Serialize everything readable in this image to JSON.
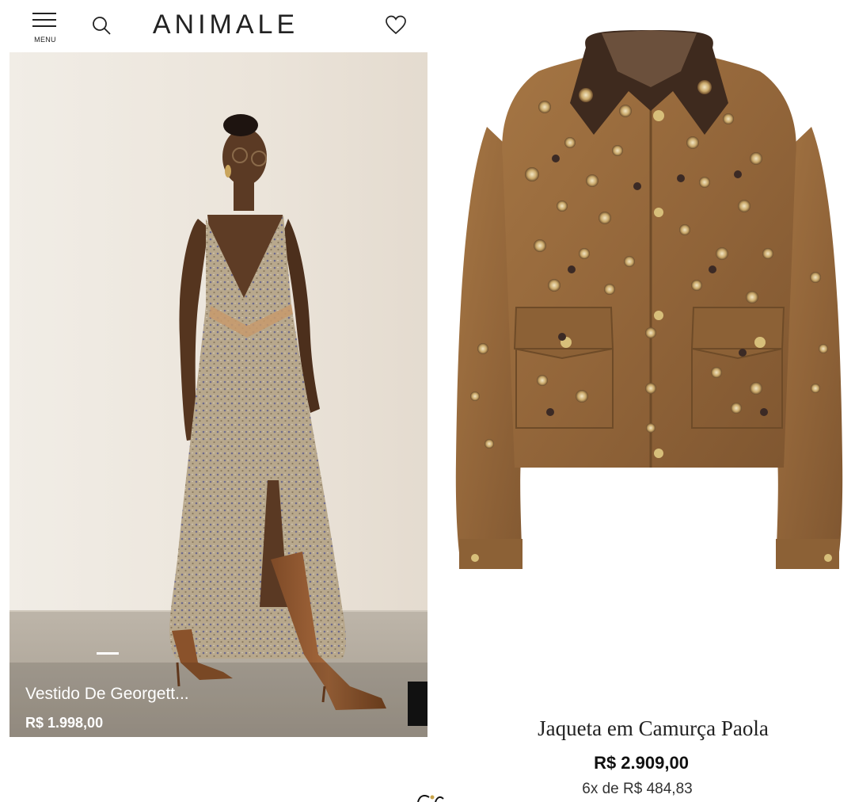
{
  "header": {
    "menu_label": "MENU",
    "logo": "ANIMALE"
  },
  "products": [
    {
      "name": "Vestido De Georgett...",
      "price": "R$ 1.998,00"
    },
    {
      "name": "Jaqueta em Camurça Paola",
      "price": "R$ 2.909,00",
      "installments": "6x de R$ 484,83"
    }
  ],
  "icons": {
    "menu": "hamburger-icon",
    "search": "search-icon",
    "favorites": "heart-icon"
  },
  "colors": {
    "background": "#ffffff",
    "text": "#222222",
    "studio_wall": "#ece6de",
    "jacket_suede": "#9a6d3c"
  }
}
